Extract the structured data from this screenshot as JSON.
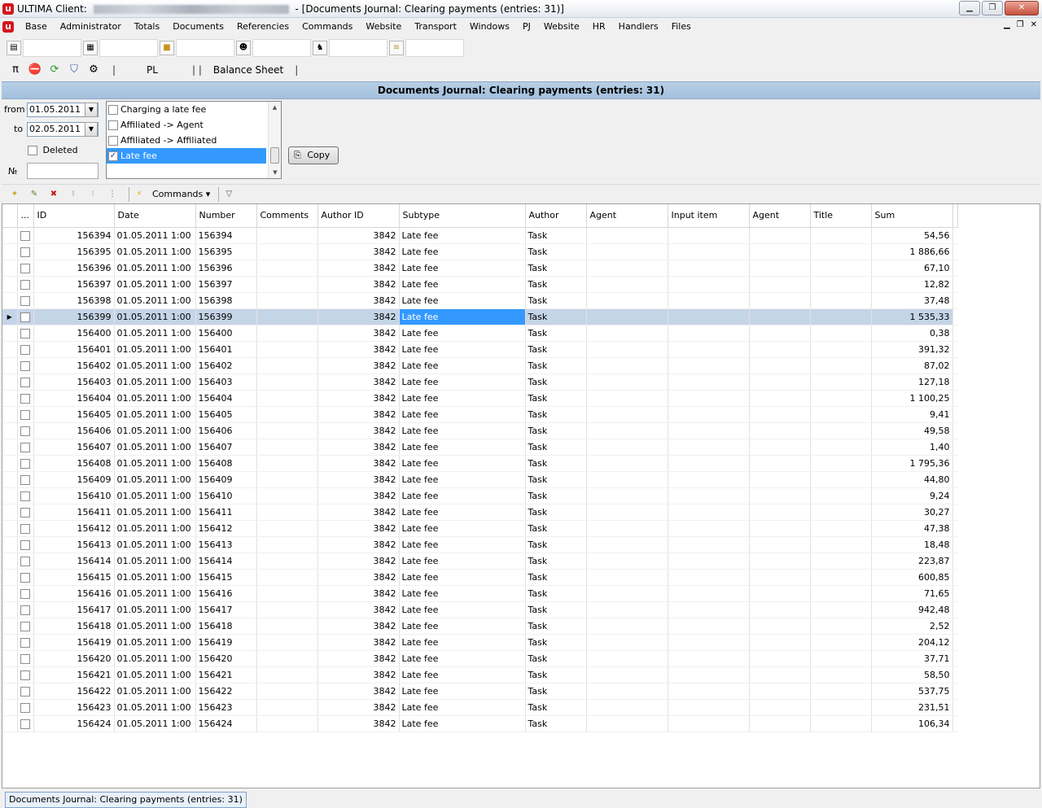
{
  "window": {
    "title_prefix": "ULTIMA Client:",
    "title_suffix": "- [Documents Journal: Clearing payments (entries: 31)]"
  },
  "menu": [
    "Base",
    "Administrator",
    "Totals",
    "Documents",
    "Referencies",
    "Commands",
    "Website",
    "Transport",
    "Windows",
    "PJ",
    "Website",
    "HR",
    "Handlers",
    "Files"
  ],
  "toolbar2": {
    "pl": "PL",
    "balance_sheet": "Balance Sheet"
  },
  "doc_header": "Documents Journal: Clearing payments (entries: 31)",
  "filter": {
    "from_label": "from",
    "to_label": "to",
    "from_value": "01.05.2011",
    "to_value": "02.05.2011",
    "deleted_label": "Deleted",
    "number_label": "№",
    "subtypes": [
      {
        "label": "Charging a late fee",
        "checked": false
      },
      {
        "label": "Affiliated -> Agent",
        "checked": false
      },
      {
        "label": "Affiliated  -> Affiliated",
        "checked": false
      },
      {
        "label": "Late fee",
        "checked": true
      }
    ],
    "copy_label": "Copy"
  },
  "grid_toolbar": {
    "commands_label": "Commands"
  },
  "columns": [
    "...",
    "ID",
    "Date",
    "Number",
    "Comments",
    "Author ID",
    "Subtype",
    "Author",
    "Agent",
    "Input item",
    "Agent",
    "Title",
    "Sum"
  ],
  "selected_row": 5,
  "rows": [
    {
      "id": "156394",
      "date": "01.05.2011 1:00",
      "number": "156394",
      "author_id": "3842",
      "subtype": "Late fee",
      "author": "Task",
      "sum": "54,56"
    },
    {
      "id": "156395",
      "date": "01.05.2011 1:00",
      "number": "156395",
      "author_id": "3842",
      "subtype": "Late fee",
      "author": "Task",
      "sum": "1 886,66"
    },
    {
      "id": "156396",
      "date": "01.05.2011 1:00",
      "number": "156396",
      "author_id": "3842",
      "subtype": "Late fee",
      "author": "Task",
      "sum": "67,10"
    },
    {
      "id": "156397",
      "date": "01.05.2011 1:00",
      "number": "156397",
      "author_id": "3842",
      "subtype": "Late fee",
      "author": "Task",
      "sum": "12,82"
    },
    {
      "id": "156398",
      "date": "01.05.2011 1:00",
      "number": "156398",
      "author_id": "3842",
      "subtype": "Late fee",
      "author": "Task",
      "sum": "37,48"
    },
    {
      "id": "156399",
      "date": "01.05.2011 1:00",
      "number": "156399",
      "author_id": "3842",
      "subtype": "Late fee",
      "author": "Task",
      "sum": "1 535,33"
    },
    {
      "id": "156400",
      "date": "01.05.2011 1:00",
      "number": "156400",
      "author_id": "3842",
      "subtype": "Late fee",
      "author": "Task",
      "sum": "0,38"
    },
    {
      "id": "156401",
      "date": "01.05.2011 1:00",
      "number": "156401",
      "author_id": "3842",
      "subtype": "Late fee",
      "author": "Task",
      "sum": "391,32"
    },
    {
      "id": "156402",
      "date": "01.05.2011 1:00",
      "number": "156402",
      "author_id": "3842",
      "subtype": "Late fee",
      "author": "Task",
      "sum": "87,02"
    },
    {
      "id": "156403",
      "date": "01.05.2011 1:00",
      "number": "156403",
      "author_id": "3842",
      "subtype": "Late fee",
      "author": "Task",
      "sum": "127,18"
    },
    {
      "id": "156404",
      "date": "01.05.2011 1:00",
      "number": "156404",
      "author_id": "3842",
      "subtype": "Late fee",
      "author": "Task",
      "sum": "1 100,25"
    },
    {
      "id": "156405",
      "date": "01.05.2011 1:00",
      "number": "156405",
      "author_id": "3842",
      "subtype": "Late fee",
      "author": "Task",
      "sum": "9,41"
    },
    {
      "id": "156406",
      "date": "01.05.2011 1:00",
      "number": "156406",
      "author_id": "3842",
      "subtype": "Late fee",
      "author": "Task",
      "sum": "49,58"
    },
    {
      "id": "156407",
      "date": "01.05.2011 1:00",
      "number": "156407",
      "author_id": "3842",
      "subtype": "Late fee",
      "author": "Task",
      "sum": "1,40"
    },
    {
      "id": "156408",
      "date": "01.05.2011 1:00",
      "number": "156408",
      "author_id": "3842",
      "subtype": "Late fee",
      "author": "Task",
      "sum": "1 795,36"
    },
    {
      "id": "156409",
      "date": "01.05.2011 1:00",
      "number": "156409",
      "author_id": "3842",
      "subtype": "Late fee",
      "author": "Task",
      "sum": "44,80"
    },
    {
      "id": "156410",
      "date": "01.05.2011 1:00",
      "number": "156410",
      "author_id": "3842",
      "subtype": "Late fee",
      "author": "Task",
      "sum": "9,24"
    },
    {
      "id": "156411",
      "date": "01.05.2011 1:00",
      "number": "156411",
      "author_id": "3842",
      "subtype": "Late fee",
      "author": "Task",
      "sum": "30,27"
    },
    {
      "id": "156412",
      "date": "01.05.2011 1:00",
      "number": "156412",
      "author_id": "3842",
      "subtype": "Late fee",
      "author": "Task",
      "sum": "47,38"
    },
    {
      "id": "156413",
      "date": "01.05.2011 1:00",
      "number": "156413",
      "author_id": "3842",
      "subtype": "Late fee",
      "author": "Task",
      "sum": "18,48"
    },
    {
      "id": "156414",
      "date": "01.05.2011 1:00",
      "number": "156414",
      "author_id": "3842",
      "subtype": "Late fee",
      "author": "Task",
      "sum": "223,87"
    },
    {
      "id": "156415",
      "date": "01.05.2011 1:00",
      "number": "156415",
      "author_id": "3842",
      "subtype": "Late fee",
      "author": "Task",
      "sum": "600,85"
    },
    {
      "id": "156416",
      "date": "01.05.2011 1:00",
      "number": "156416",
      "author_id": "3842",
      "subtype": "Late fee",
      "author": "Task",
      "sum": "71,65"
    },
    {
      "id": "156417",
      "date": "01.05.2011 1:00",
      "number": "156417",
      "author_id": "3842",
      "subtype": "Late fee",
      "author": "Task",
      "sum": "942,48"
    },
    {
      "id": "156418",
      "date": "01.05.2011 1:00",
      "number": "156418",
      "author_id": "3842",
      "subtype": "Late fee",
      "author": "Task",
      "sum": "2,52"
    },
    {
      "id": "156419",
      "date": "01.05.2011 1:00",
      "number": "156419",
      "author_id": "3842",
      "subtype": "Late fee",
      "author": "Task",
      "sum": "204,12"
    },
    {
      "id": "156420",
      "date": "01.05.2011 1:00",
      "number": "156420",
      "author_id": "3842",
      "subtype": "Late fee",
      "author": "Task",
      "sum": "37,71"
    },
    {
      "id": "156421",
      "date": "01.05.2011 1:00",
      "number": "156421",
      "author_id": "3842",
      "subtype": "Late fee",
      "author": "Task",
      "sum": "58,50"
    },
    {
      "id": "156422",
      "date": "01.05.2011 1:00",
      "number": "156422",
      "author_id": "3842",
      "subtype": "Late fee",
      "author": "Task",
      "sum": "537,75"
    },
    {
      "id": "156423",
      "date": "01.05.2011 1:00",
      "number": "156423",
      "author_id": "3842",
      "subtype": "Late fee",
      "author": "Task",
      "sum": "231,51"
    },
    {
      "id": "156424",
      "date": "01.05.2011 1:00",
      "number": "156424",
      "author_id": "3842",
      "subtype": "Late fee",
      "author": "Task",
      "sum": "106,34"
    }
  ],
  "status_tab": "Documents Journal: Clearing payments (entries: 31)"
}
